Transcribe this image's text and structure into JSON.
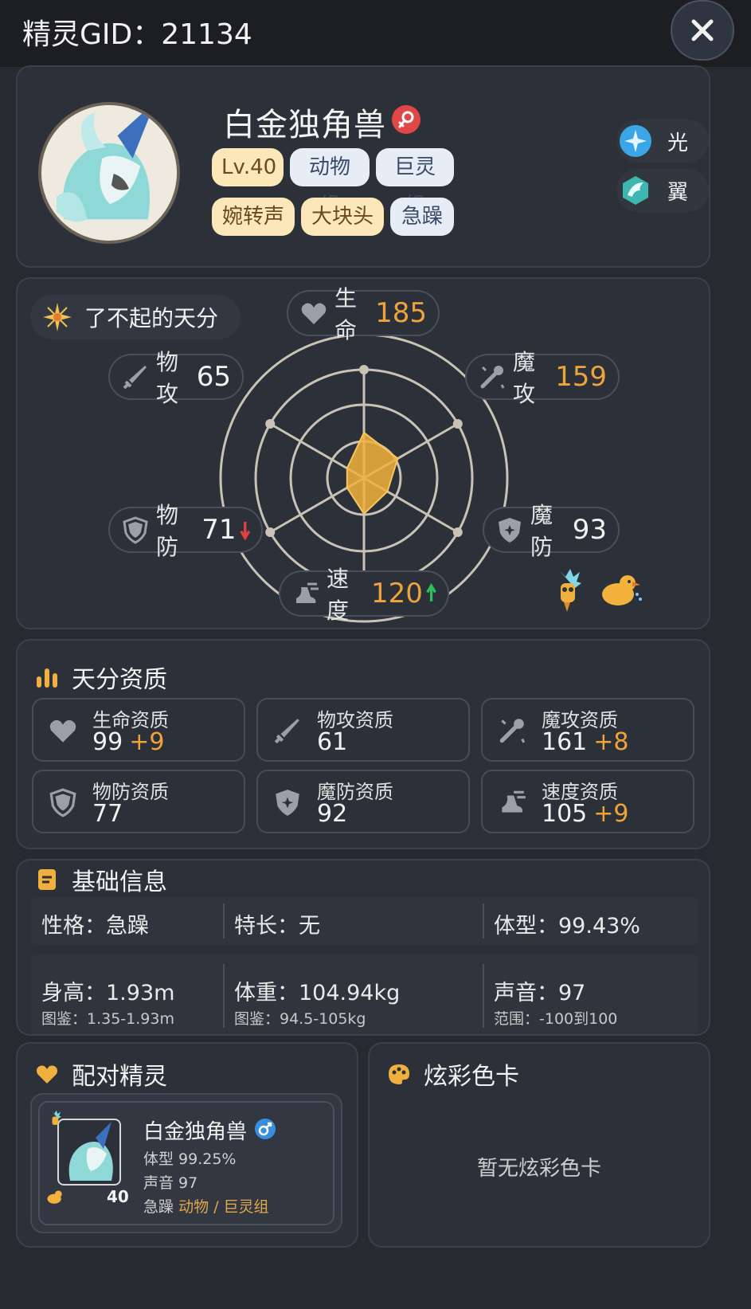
{
  "topbar": {
    "gid_label": "精灵GID：21134"
  },
  "pet": {
    "name": "白金独角兽",
    "tags_row1": [
      "Lv.40",
      "动物组",
      "巨灵组"
    ],
    "tags_row2": [
      "婉转声",
      "大块头",
      "急躁"
    ],
    "elements": [
      {
        "label": "光",
        "icon": "light-element-icon",
        "color": "#3aa6e8"
      },
      {
        "label": "翼",
        "icon": "wing-element-icon",
        "color": "#3fb6b0"
      }
    ]
  },
  "talent": {
    "label": "了不起的天分"
  },
  "stats": {
    "hp": {
      "label": "生命",
      "value": "185"
    },
    "atk": {
      "label": "物攻",
      "value": "65"
    },
    "matk": {
      "label": "魔攻",
      "value": "159"
    },
    "def": {
      "label": "物防",
      "value": "71"
    },
    "mdef": {
      "label": "魔防",
      "value": "93"
    },
    "spd": {
      "label": "速度",
      "value": "120"
    }
  },
  "radar_levels": {
    "hp": 0.42,
    "matk": 0.36,
    "mdef": 0.25,
    "spd": 0.33,
    "def": 0.18,
    "atk": 0.18
  },
  "aptitude": {
    "title": "天分资质",
    "items": [
      {
        "label": "生命资质",
        "value": "99",
        "bonus": "+9"
      },
      {
        "label": "物攻资质",
        "value": "61",
        "bonus": ""
      },
      {
        "label": "魔攻资质",
        "value": "161",
        "bonus": "+8"
      },
      {
        "label": "物防资质",
        "value": "77",
        "bonus": ""
      },
      {
        "label": "魔防资质",
        "value": "92",
        "bonus": ""
      },
      {
        "label": "速度资质",
        "value": "105",
        "bonus": "+9"
      }
    ]
  },
  "basic": {
    "title": "基础信息",
    "nature": "性格：急躁",
    "specialty": "特长：无",
    "size": "体型：99.43%",
    "height": "身高：1.93m",
    "height_range": "图鉴：1.35-1.93m",
    "weight": "体重：104.94kg",
    "weight_range": "图鉴：94.5-105kg",
    "voice": "声音：97",
    "voice_range": "范围：-100到100"
  },
  "pair": {
    "title": "配对精灵",
    "name": "白金独角兽",
    "size": "体型 99.25%",
    "voice": "声音 97",
    "nature": "急躁",
    "groups": "动物 / 巨灵组",
    "level": "40"
  },
  "color_card": {
    "title": "炫彩色卡",
    "empty": "暂无炫彩色卡"
  },
  "colors": {
    "accent_orange": "#f0a33a",
    "bg": "#262a31",
    "card": "#2b3039",
    "gold_tag": "#fbe7b8",
    "blue_tag": "#e6edf7"
  }
}
